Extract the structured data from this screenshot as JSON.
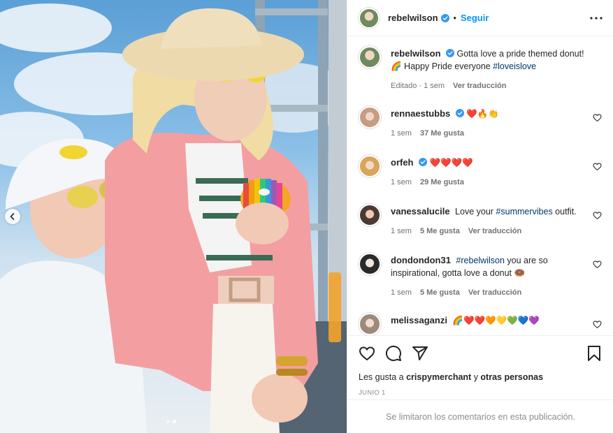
{
  "header": {
    "username": "rebelwilson",
    "separator": "•",
    "follow_label": "Seguir",
    "more_icon": "more-horizontal-icon"
  },
  "caption": {
    "username": "rebelwilson",
    "text_1": "Gotta love a pride themed donut! 🌈 Happy Pride everyone ",
    "hashtag": "#loveislove",
    "edited": "Editado · 1 sem",
    "translate": "Ver traducción"
  },
  "comments": [
    {
      "username": "rennaestubbs",
      "verified": true,
      "text": "❤️🔥👏",
      "age": "1 sem",
      "likes": "37 Me gusta"
    },
    {
      "username": "orfeh",
      "verified": true,
      "text": "❤️❤️❤️❤️",
      "age": "1 sem",
      "likes": "29 Me gusta"
    },
    {
      "username": "vanessalucile",
      "verified": false,
      "text_before": "Love your ",
      "hashtag": "#summervibes",
      "text_after": " outfit.",
      "age": "1 sem",
      "likes": "5 Me gusta",
      "translate": "Ver traducción"
    },
    {
      "username": "dondondon31",
      "verified": false,
      "hashtag": "#rebelwilson",
      "text_after": " you are so inspirational, gotta love a donut 🍩",
      "age": "1 sem",
      "likes": "5 Me gusta",
      "translate": "Ver traducción"
    },
    {
      "username": "melissaganzi",
      "verified": false,
      "text": "🌈❤️❤️🧡💛💚💙💜"
    }
  ],
  "actions": {
    "like_icon": "heart-icon",
    "comment_icon": "comment-icon",
    "share_icon": "send-icon",
    "save_icon": "bookmark-icon",
    "likes_prefix": "Les gusta a ",
    "likes_user": "crispymerchant",
    "likes_mid": " y ",
    "likes_others": "otras personas",
    "date": "JUNIO 1"
  },
  "footer": {
    "limited_text": "Se limitaron los comentarios en esta publicación."
  },
  "colors": {
    "accent": "#0095f6",
    "verified": "#3897f0",
    "hashtag": "#00376b",
    "muted": "#737373"
  }
}
